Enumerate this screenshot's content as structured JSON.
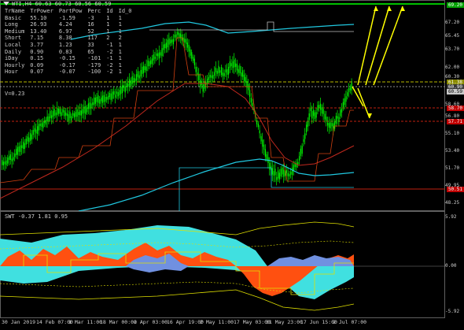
{
  "chart": {
    "symbol_line": "WTI,H4 60.63 60.73 60.56 60.59",
    "indicator_label": "SWT -0.37 1.81 0.95",
    "v_label": "V=0.23"
  },
  "info_table": {
    "headers": [
      "TrName",
      "TrPower",
      "PartPow",
      "Perc",
      "Id",
      "Id_0"
    ],
    "rows": [
      [
        "Basic",
        "55.10",
        "-1.59",
        "-3",
        "1",
        "1"
      ],
      [
        "Long",
        "26.93",
        "4.24",
        "16",
        "1",
        "1"
      ],
      [
        "Medium",
        "13.40",
        "6.97",
        "52",
        "1",
        "1"
      ],
      [
        "Short",
        "7.15",
        "8.38",
        "117",
        "2",
        "2"
      ],
      [
        "Local",
        "3.77",
        "1.23",
        "33",
        "-1",
        "1"
      ],
      [
        "Daily",
        "0.90",
        "0.83",
        "65",
        "-2",
        "1"
      ],
      [
        "iDay",
        "0.15",
        "-0.15",
        "-101",
        "-1",
        "1"
      ],
      [
        "Hourly",
        "0.09",
        "-0.17",
        "-179",
        "-2",
        "1"
      ],
      [
        "Hour",
        "0.07",
        "-0.07",
        "-100",
        "-2",
        "1"
      ]
    ]
  },
  "price_axis": {
    "ticks": [
      "67.20",
      "65.45",
      "63.70",
      "62.00",
      "60.30",
      "58.60",
      "56.80",
      "55.10",
      "53.40",
      "51.70",
      "49.95",
      "48.25"
    ]
  },
  "price_tags": [
    {
      "label": "69.20",
      "color": "#00a000",
      "text_color": "#ffffff",
      "value": 69.2
    },
    {
      "label": "61.38",
      "color": "#8a8a00",
      "text_color": "#ffffff",
      "value": 61.38
    },
    {
      "label": "60.90",
      "color": "#3a3a3a",
      "text_color": "#ffffff",
      "value": 60.9
    },
    {
      "label": "60.59",
      "color": "#c8c8c8",
      "text_color": "#000000",
      "value": 60.59
    },
    {
      "label": "58.70",
      "color": "#c00000",
      "text_color": "#ffffff",
      "value": 58.7
    },
    {
      "label": "57.71",
      "color": "#c00000",
      "text_color": "#ffffff",
      "value": 57.71
    },
    {
      "label": "50.51",
      "color": "#c00000",
      "text_color": "#ffffff",
      "value": 50.51
    }
  ],
  "sub_axis": {
    "ticks": [
      "5.92",
      "0.00",
      "-5.92"
    ]
  },
  "time_axis": {
    "ticks": [
      "30 Jan 2019",
      "14 Feb 07:00",
      "1 Mar 11:00",
      "18 Mar 00:00",
      "2 Apr 03:00",
      "16 Apr 19:00",
      "2 May 11:00",
      "17 May 03:00",
      "31 May 23:00",
      "17 Jun 15:00",
      "2 Jul 07:00"
    ]
  },
  "colors": {
    "candle": "#00ff00",
    "ma_red": "#c0281e",
    "ma_cyan": "#20c8e0",
    "step_red": "#d04010",
    "forecast": "#ffff00",
    "swt_cyan": "#40e0e0",
    "swt_orange": "#ff5010",
    "swt_blue": "#7090e0",
    "swt_yellow": "#e0e000"
  }
}
